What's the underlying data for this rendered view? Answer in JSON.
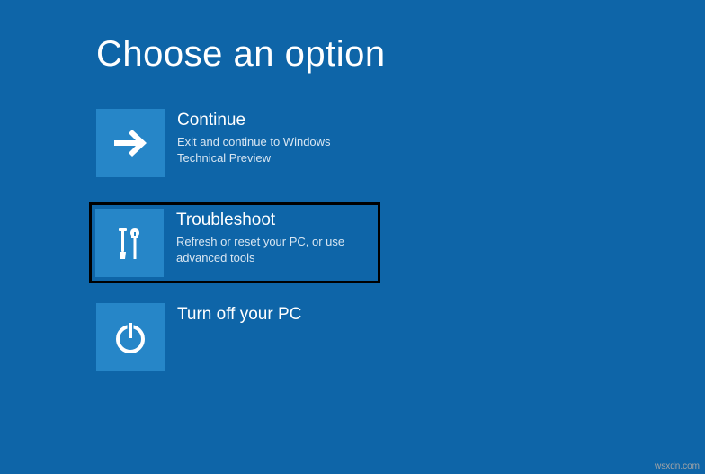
{
  "page": {
    "title": "Choose an option"
  },
  "options": [
    {
      "title": "Continue",
      "desc": "Exit and continue to Windows Technical Preview"
    },
    {
      "title": "Troubleshoot",
      "desc": "Refresh or reset your PC, or use advanced tools"
    },
    {
      "title": "Turn off your PC",
      "desc": ""
    }
  ],
  "watermark": "wsxdn.com"
}
